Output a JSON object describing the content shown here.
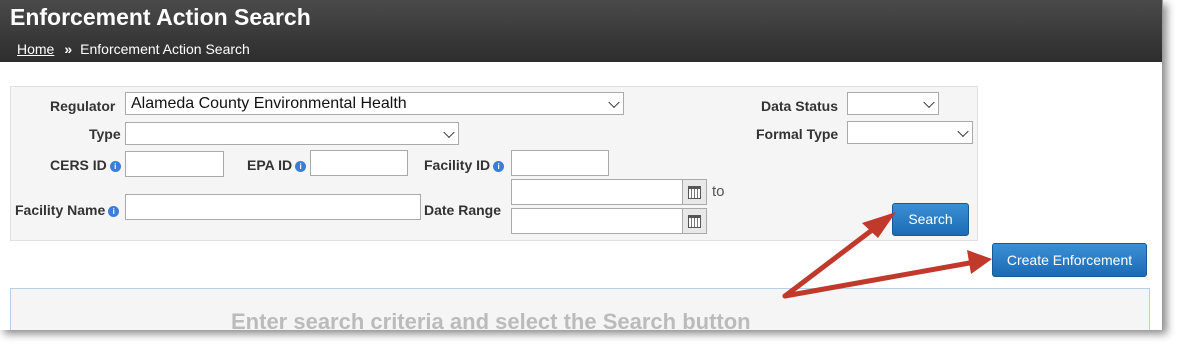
{
  "header": {
    "title": "Enforcement Action Search",
    "breadcrumb": {
      "home": "Home",
      "separator": "»",
      "current": "Enforcement Action Search"
    }
  },
  "form": {
    "regulator": {
      "label": "Regulator",
      "value": "Alameda County Environmental Health"
    },
    "type": {
      "label": "Type",
      "value": ""
    },
    "cers_id": {
      "label": "CERS ID",
      "value": ""
    },
    "epa_id": {
      "label": "EPA ID",
      "value": ""
    },
    "facility_id": {
      "label": "Facility ID",
      "value": ""
    },
    "facility_name": {
      "label": "Facility Name",
      "value": ""
    },
    "date_range": {
      "label": "Date Range",
      "to": "to",
      "from_value": "",
      "to_value": ""
    },
    "data_status": {
      "label": "Data Status",
      "value": ""
    },
    "formal_type": {
      "label": "Formal Type",
      "value": ""
    },
    "info_glyph": "i"
  },
  "buttons": {
    "search": "Search",
    "create": "Create Enforcement"
  },
  "results": {
    "message": "Enter search criteria and select the Search button"
  },
  "colors": {
    "header_bg": "#333333",
    "button_blue": "#2a7cc7",
    "arrow_red": "#c0392b"
  },
  "icons": [
    "info-icon",
    "calendar-icon",
    "chevron-down-icon",
    "annotation-arrow"
  ]
}
